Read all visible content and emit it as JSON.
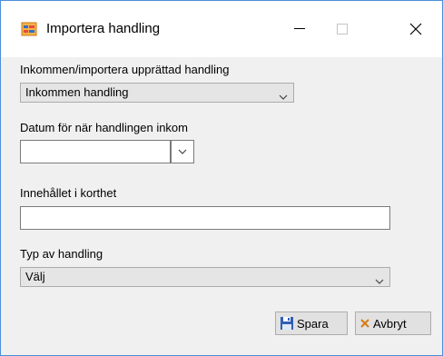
{
  "window": {
    "title": "Importera handling",
    "icon": "app-form-icon",
    "minimize_icon": "minimize-icon",
    "maximize_icon": "maximize-icon",
    "close_icon": "close-icon"
  },
  "form": {
    "type_label": "Inkommen/importera upprättad handling",
    "type_value": "Inkommen handling",
    "date_label": "Datum för när handlingen inkom",
    "date_value": "",
    "content_label": "Innehållet i korthet",
    "content_value": "",
    "doc_type_label": "Typ av handling",
    "doc_type_value": "Välj"
  },
  "buttons": {
    "save_label": "Spara",
    "save_icon": "floppy-disk-icon",
    "cancel_label": "Avbryt",
    "cancel_icon": "x-icon"
  },
  "colors": {
    "window_border": "#4a8fd8",
    "background": "#f0f0f0"
  }
}
